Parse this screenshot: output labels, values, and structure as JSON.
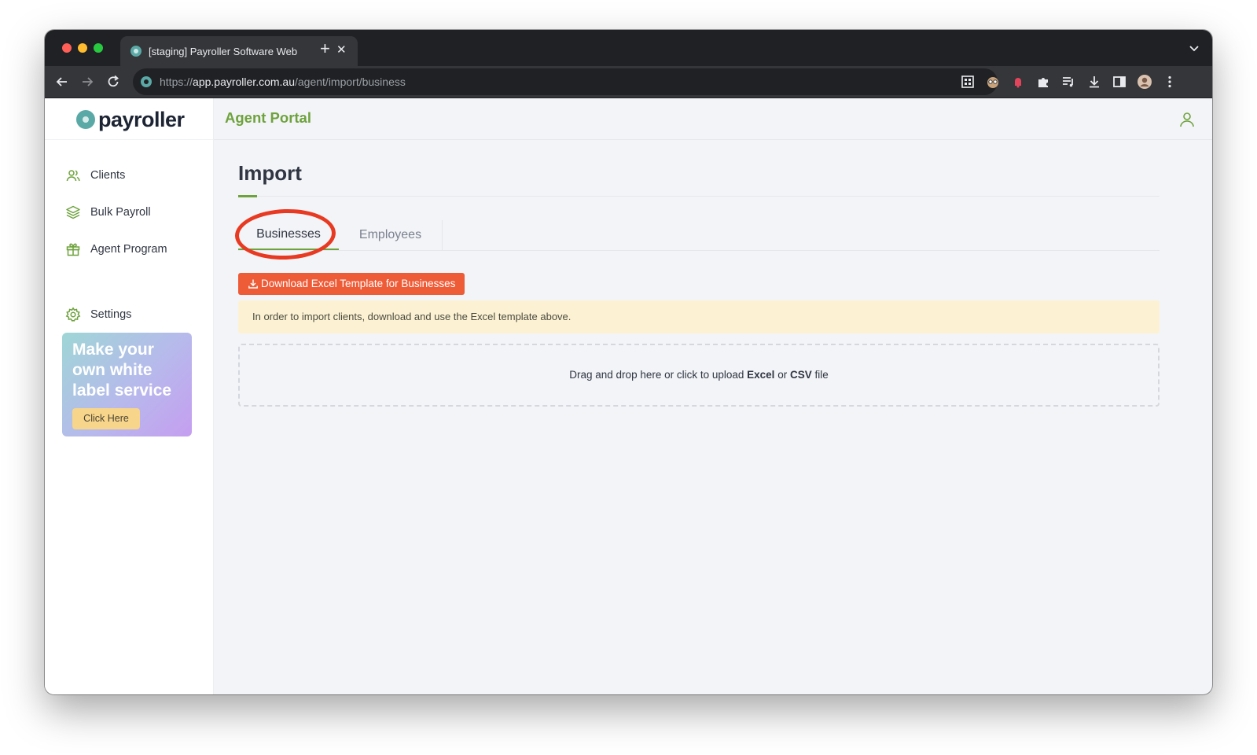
{
  "browser": {
    "tab_title": "[staging] Payroller Software Web",
    "url_scheme": "https://",
    "url_host": "app.payroller.com.au",
    "url_path": "/agent/import/business"
  },
  "brand": {
    "logo_text": "payroller",
    "portal_title": "Agent Portal",
    "accent_color": "#6ea23d",
    "teal_color": "#5aa9a6",
    "button_color": "#ee5b37",
    "annotation_color": "#e83a22"
  },
  "sidebar": {
    "items": [
      {
        "label": "Clients",
        "icon": "users-icon"
      },
      {
        "label": "Bulk Payroll",
        "icon": "layers-icon"
      },
      {
        "label": "Agent Program",
        "icon": "gift-icon"
      },
      {
        "label": "Settings",
        "icon": "gear-icon"
      }
    ],
    "promo": {
      "text": "Make your own white label service",
      "button": "Click Here"
    }
  },
  "main": {
    "title": "Import",
    "tabs": [
      {
        "label": "Businesses",
        "active": true
      },
      {
        "label": "Employees",
        "active": false
      }
    ],
    "download_button": "Download Excel Template for Businesses",
    "alert_text": "In order to import clients, download and use the Excel template above.",
    "dropzone": {
      "prefix": "Drag and drop here or click to upload ",
      "format1": "Excel",
      "joiner": " or ",
      "format2": "CSV",
      "suffix": " file"
    }
  }
}
